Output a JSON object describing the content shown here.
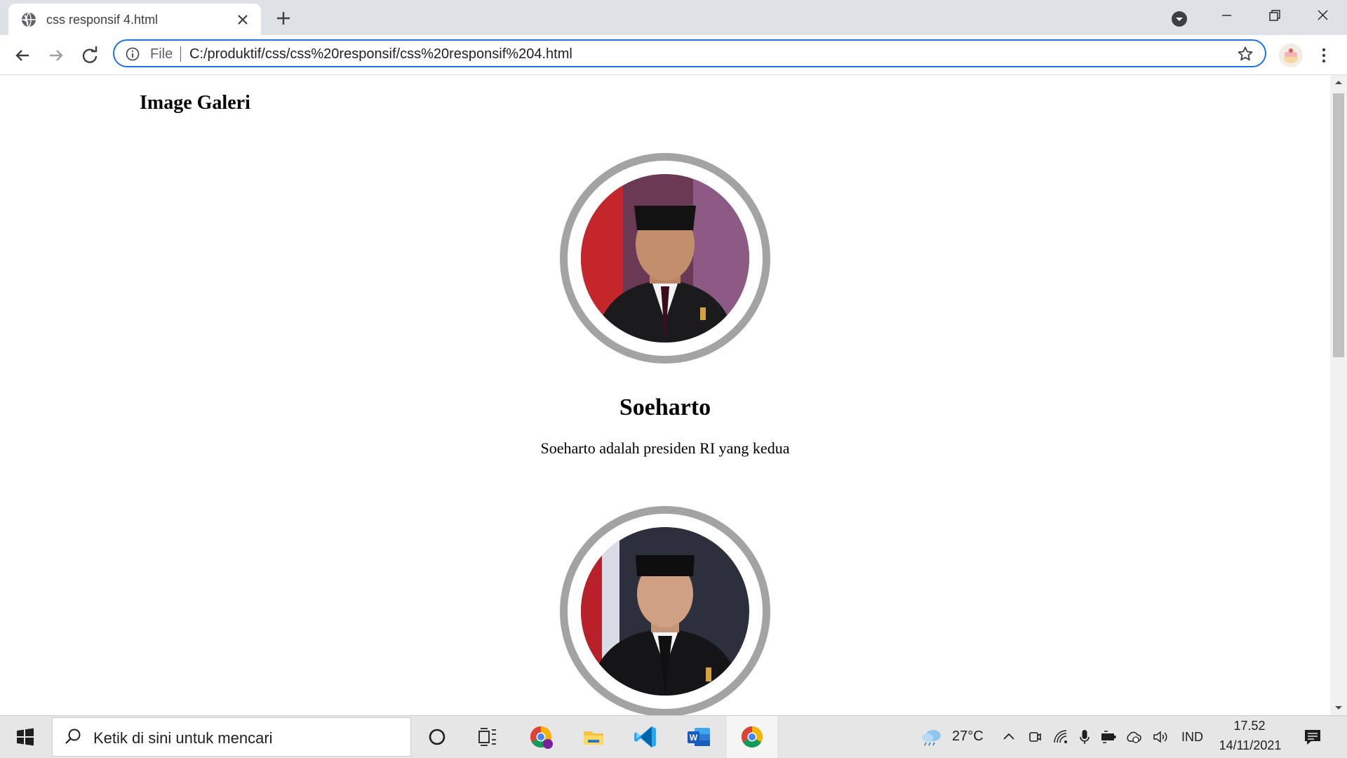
{
  "browser": {
    "tab_title": "css responsif 4.html",
    "scheme_label": "File",
    "url": "C:/produktif/css/css%20responsif/css%20responsif%204.html",
    "accent_color": "#1a73e8",
    "tabstrip_color": "#dee1e6"
  },
  "page": {
    "heading": "Image Galeri",
    "items": [
      {
        "name": "Soeharto",
        "description": "Soeharto adalah presiden RI yang kedua"
      },
      {
        "name": "",
        "description": ""
      }
    ],
    "frame_color": "#a3a3a3"
  },
  "taskbar": {
    "search_placeholder": "Ketik di sini untuk mencari",
    "temperature": "27°C",
    "language": "IND",
    "time": "17.52",
    "date": "14/11/2021",
    "pinned_apps": [
      "cortana-icon",
      "task-view-icon",
      "chrome-profile-icon",
      "file-explorer-icon",
      "vscode-icon",
      "word-icon",
      "chrome-icon"
    ]
  }
}
